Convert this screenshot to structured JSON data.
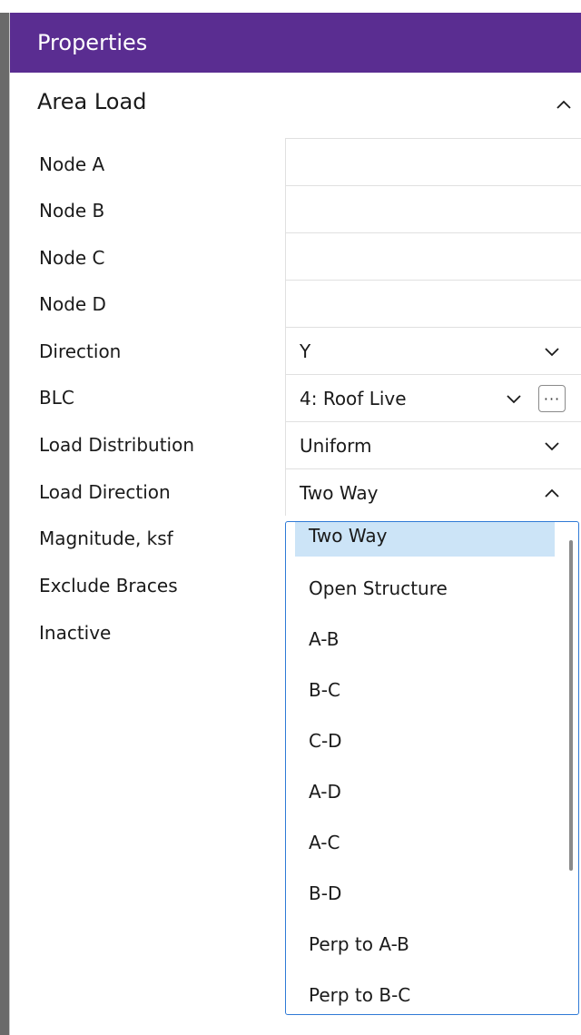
{
  "panel": {
    "title": "Properties",
    "section_title": "Area Load"
  },
  "rows": [
    {
      "label": "Node A",
      "value": ""
    },
    {
      "label": "Node B",
      "value": ""
    },
    {
      "label": "Node C",
      "value": ""
    },
    {
      "label": "Node D",
      "value": ""
    },
    {
      "label": "Direction",
      "value": "Y"
    },
    {
      "label": "BLC",
      "value": "4: Roof Live"
    },
    {
      "label": "Load Distribution",
      "value": "Uniform"
    },
    {
      "label": "Load Direction",
      "value": "Two Way"
    },
    {
      "label": "Magnitude, ksf",
      "value": ""
    },
    {
      "label": "Exclude Braces",
      "value": ""
    },
    {
      "label": "Inactive",
      "value": ""
    }
  ],
  "dropdown": {
    "selected": "Two Way",
    "options": [
      "Two Way",
      "Open Structure",
      "A-B",
      "B-C",
      "C-D",
      "A-D",
      "A-C",
      "B-D",
      "Perp to A-B",
      "Perp to B-C"
    ]
  },
  "icons": {
    "collapse": "chevron-up-icon",
    "dropdown": "chevron-down-icon",
    "browse": "ellipsis-icon"
  },
  "colors": {
    "header_bg": "#5a2d91",
    "header_text": "#ffffff",
    "dropdown_border": "#2f7ad6",
    "selected_option_bg": "#cce4f7"
  }
}
